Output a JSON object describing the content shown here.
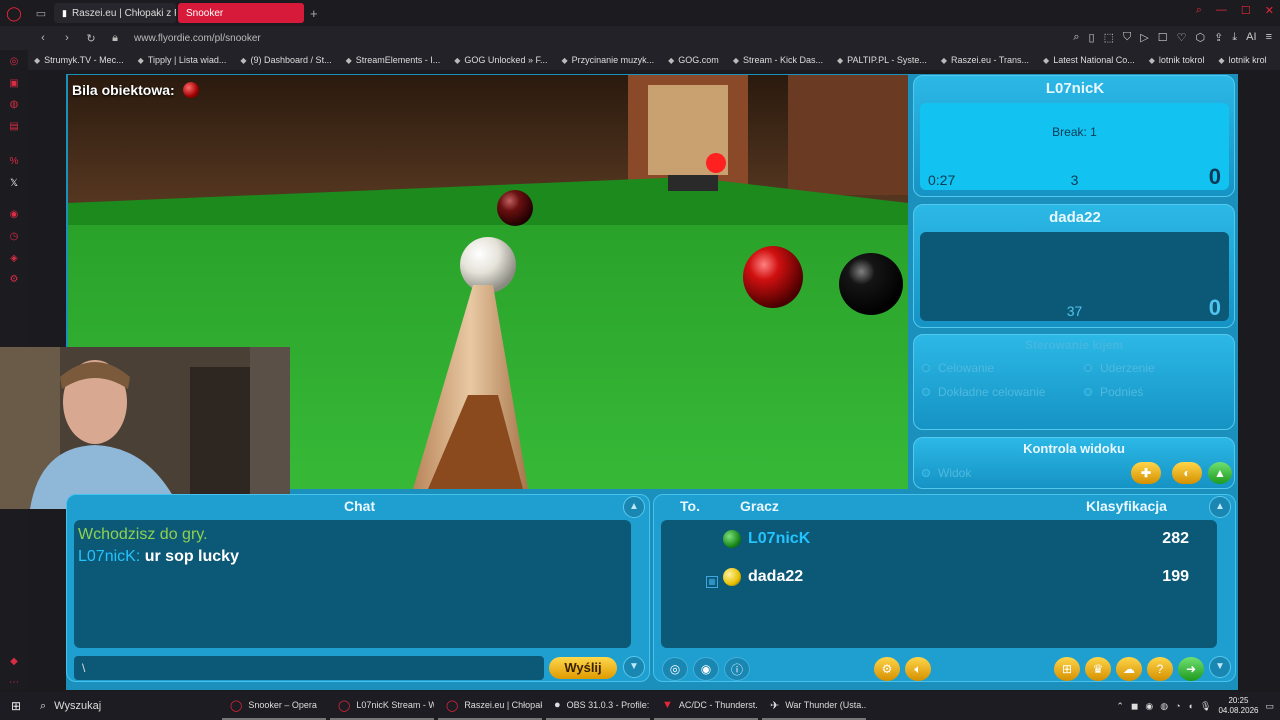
{
  "browser": {
    "tabs": [
      {
        "label": "Raszei.eu | Chłopaki z Ras",
        "active": false
      },
      {
        "label": "Snooker",
        "active": true
      }
    ],
    "url": "www.flyordie.com/pl/snooker",
    "bookmarks": [
      "Strumyk.TV - Mec...",
      "Tipply | Lista wiad...",
      "(9) Dashboard / St...",
      "StreamElements - I...",
      "GOG Unlocked » F...",
      "Przycinanie muzyk...",
      "GOG.com",
      "Stream - Kick Das...",
      "PALTIP.PL - Syste...",
      "Raszei.eu - Trans...",
      "Latest National Co...",
      "lotnik tokrol",
      "lotnik krol"
    ],
    "addr_right_label": "AI"
  },
  "game": {
    "object_ball_label": "Bila obiektowa:",
    "player1": {
      "name": "L07nicK",
      "break_label": "Break: 1",
      "timer": "0:27",
      "mid": "3",
      "score": "0"
    },
    "player2": {
      "name": "dada22",
      "mid": "37",
      "score": "0"
    },
    "controls": {
      "title": "Sterowanie kijem",
      "items": [
        "Celowanie",
        "Uderzenie",
        "Dokładne celowanie",
        "Podnieś"
      ]
    },
    "view_control": {
      "title": "Kontrola widoku",
      "item": "Widok"
    },
    "chat": {
      "header": "Chat",
      "lines": [
        {
          "type": "system",
          "text": "Wchodzisz do gry."
        },
        {
          "type": "user",
          "user": "L07nicK:",
          "text": "ur sop lucky"
        }
      ],
      "input_value": "\\",
      "send_label": "Wyślij"
    },
    "players_table": {
      "headers": [
        "To.",
        "Gracz",
        "Klasyfikacja"
      ],
      "rows": [
        {
          "name": "L07nicK",
          "rating": "282",
          "ball_color": "#1a8a1a",
          "name_color": "#23c3ff"
        },
        {
          "name": "dada22",
          "rating": "199",
          "ball_color": "#e8c000",
          "name_color": "#ffffff"
        }
      ]
    }
  },
  "taskbar": {
    "search_label": "Wyszukaj",
    "tasks": [
      "Snooker – Opera",
      "L07nicK Stream - W...",
      "Raszei.eu | Chłopak...",
      "OBS 31.0.3 - Profile:...",
      "AC/DC - Thunderst...",
      "War Thunder (Usta..."
    ],
    "time": "20:25",
    "date": "04.08.2026"
  },
  "colors": {
    "accent": "#d81a3a",
    "panel": "#1f9fd0",
    "felt": "#2fae2f"
  }
}
